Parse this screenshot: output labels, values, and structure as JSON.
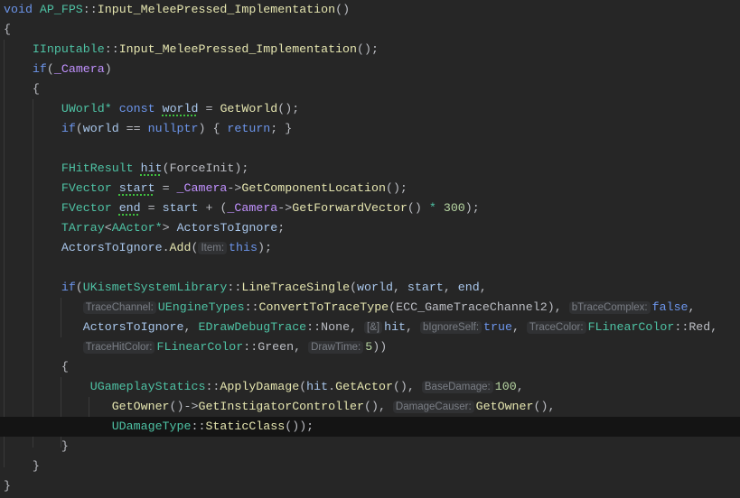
{
  "editor": {
    "current_line": 21,
    "lines": [
      [
        [
          "kw",
          "void "
        ],
        [
          "ty",
          "AP_FPS"
        ],
        [
          "txt",
          "::"
        ],
        [
          "fn",
          "Input_MeleePressed_Implementation"
        ],
        [
          "txt",
          "()"
        ]
      ],
      [
        [
          "txt",
          "{"
        ]
      ],
      [
        [
          "txt",
          "    "
        ],
        [
          "ty",
          "IInputable"
        ],
        [
          "txt",
          "::"
        ],
        [
          "fn",
          "Input_MeleePressed_Implementation"
        ],
        [
          "txt",
          "();"
        ]
      ],
      [
        [
          "txt",
          "    "
        ],
        [
          "kw",
          "if"
        ],
        [
          "txt",
          "("
        ],
        [
          "mem",
          "_Camera"
        ],
        [
          "txt",
          ")"
        ]
      ],
      [
        [
          "txt",
          "    {"
        ]
      ],
      [
        [
          "txt",
          "        "
        ],
        [
          "ty",
          "UWorld"
        ],
        [
          "ty",
          "* "
        ],
        [
          "kw",
          "const "
        ],
        [
          "var unused",
          "world"
        ],
        [
          "txt",
          " = "
        ],
        [
          "fn",
          "GetWorld"
        ],
        [
          "txt",
          "();"
        ]
      ],
      [
        [
          "txt",
          "        "
        ],
        [
          "kw",
          "if"
        ],
        [
          "txt",
          "("
        ],
        [
          "var",
          "world"
        ],
        [
          "txt",
          " == "
        ],
        [
          "kw",
          "nullptr"
        ],
        [
          "txt",
          ") { "
        ],
        [
          "kw",
          "return"
        ],
        [
          "txt",
          "; }"
        ]
      ],
      [
        [
          "txt",
          ""
        ]
      ],
      [
        [
          "txt",
          "        "
        ],
        [
          "ty",
          "FHitResult "
        ],
        [
          "var unused",
          "hit"
        ],
        [
          "txt",
          "("
        ],
        [
          "txt",
          "ForceInit"
        ],
        [
          "txt",
          ");"
        ]
      ],
      [
        [
          "txt",
          "        "
        ],
        [
          "ty",
          "FVector "
        ],
        [
          "var unused",
          "start"
        ],
        [
          "txt",
          " = "
        ],
        [
          "mem",
          "_Camera"
        ],
        [
          "txt",
          "->"
        ],
        [
          "fn",
          "GetComponentLocation"
        ],
        [
          "txt",
          "();"
        ]
      ],
      [
        [
          "txt",
          "        "
        ],
        [
          "ty",
          "FVector "
        ],
        [
          "var unused",
          "end"
        ],
        [
          "txt",
          " = "
        ],
        [
          "var",
          "start"
        ],
        [
          "txt",
          " + ("
        ],
        [
          "mem",
          "_Camera"
        ],
        [
          "txt",
          "->"
        ],
        [
          "fn",
          "GetForwardVector"
        ],
        [
          "txt",
          "() "
        ],
        [
          "ty",
          "*"
        ],
        [
          "txt",
          " "
        ],
        [
          "num",
          "300"
        ],
        [
          "txt",
          ");"
        ]
      ],
      [
        [
          "txt",
          "        "
        ],
        [
          "ty",
          "TArray"
        ],
        [
          "txt",
          "<"
        ],
        [
          "ty",
          "AActor"
        ],
        [
          "ty",
          "*"
        ],
        [
          "txt",
          "> "
        ],
        [
          "var",
          "ActorsToIgnore"
        ],
        [
          "txt",
          ";"
        ]
      ],
      [
        [
          "txt",
          "        "
        ],
        [
          "var",
          "ActorsToIgnore"
        ],
        [
          "txt",
          "."
        ],
        [
          "fn",
          "Add"
        ],
        [
          "txt",
          "("
        ],
        [
          "hint",
          "Item:"
        ],
        [
          "kw",
          "this"
        ],
        [
          "txt",
          ");"
        ]
      ],
      [
        [
          "txt",
          ""
        ]
      ],
      [
        [
          "txt",
          "        "
        ],
        [
          "kw",
          "if"
        ],
        [
          "txt",
          "("
        ],
        [
          "ty",
          "UKismetSystemLibrary"
        ],
        [
          "txt",
          "::"
        ],
        [
          "fn",
          "LineTraceSingle"
        ],
        [
          "txt",
          "("
        ],
        [
          "var",
          "world"
        ],
        [
          "txt",
          ", "
        ],
        [
          "var",
          "start"
        ],
        [
          "txt",
          ", "
        ],
        [
          "var",
          "end"
        ],
        [
          "txt",
          ","
        ]
      ],
      [
        [
          "txt",
          "           "
        ],
        [
          "hint",
          "TraceChannel:"
        ],
        [
          "ty",
          "UEngineTypes"
        ],
        [
          "txt",
          "::"
        ],
        [
          "fn",
          "ConvertToTraceType"
        ],
        [
          "txt",
          "("
        ],
        [
          "txt",
          "ECC_GameTraceChannel2"
        ],
        [
          "txt",
          "), "
        ],
        [
          "hint",
          "bTraceComplex:"
        ],
        [
          "kw",
          "false"
        ],
        [
          "txt",
          ","
        ]
      ],
      [
        [
          "txt",
          "           "
        ],
        [
          "var",
          "ActorsToIgnore"
        ],
        [
          "txt",
          ", "
        ],
        [
          "ty",
          "EDrawDebugTrace"
        ],
        [
          "txt",
          "::"
        ],
        [
          "txt",
          "None"
        ],
        [
          "txt",
          ", "
        ],
        [
          "hint",
          "[&]"
        ],
        [
          "var",
          "hit"
        ],
        [
          "txt",
          ", "
        ],
        [
          "hint",
          "bIgnoreSelf:"
        ],
        [
          "kw",
          "true"
        ],
        [
          "txt",
          ", "
        ],
        [
          "hint",
          "TraceColor:"
        ],
        [
          "ty",
          "FLinearColor"
        ],
        [
          "txt",
          "::"
        ],
        [
          "txt",
          "Red"
        ],
        [
          "txt",
          ","
        ]
      ],
      [
        [
          "txt",
          "           "
        ],
        [
          "hint",
          "TraceHitColor:"
        ],
        [
          "ty",
          "FLinearColor"
        ],
        [
          "txt",
          "::"
        ],
        [
          "txt",
          "Green"
        ],
        [
          "txt",
          ", "
        ],
        [
          "hint",
          "DrawTime:"
        ],
        [
          "num",
          "5"
        ],
        [
          "txt",
          "))"
        ]
      ],
      [
        [
          "txt",
          "        {"
        ]
      ],
      [
        [
          "txt",
          "            "
        ],
        [
          "ty",
          "UGameplayStatics"
        ],
        [
          "txt",
          "::"
        ],
        [
          "fn",
          "ApplyDamage"
        ],
        [
          "txt",
          "("
        ],
        [
          "var",
          "hit"
        ],
        [
          "txt",
          "."
        ],
        [
          "fn",
          "GetActor"
        ],
        [
          "txt",
          "(), "
        ],
        [
          "hint",
          "BaseDamage:"
        ],
        [
          "num",
          "100"
        ],
        [
          "txt",
          ","
        ]
      ],
      [
        [
          "txt",
          "               "
        ],
        [
          "fn",
          "GetOwner"
        ],
        [
          "txt",
          "()->"
        ],
        [
          "fn",
          "GetInstigatorController"
        ],
        [
          "txt",
          "(), "
        ],
        [
          "hint",
          "DamageCauser:"
        ],
        [
          "fn",
          "GetOwner"
        ],
        [
          "txt",
          "(),"
        ]
      ],
      [
        [
          "txt",
          "               "
        ],
        [
          "ty",
          "UDamageType"
        ],
        [
          "txt",
          "::"
        ],
        [
          "fn",
          "StaticClass"
        ],
        [
          "txt",
          "());"
        ]
      ],
      [
        [
          "txt",
          "        }"
        ]
      ],
      [
        [
          "txt",
          "    }"
        ]
      ],
      [
        [
          "txt",
          "}"
        ]
      ]
    ]
  }
}
